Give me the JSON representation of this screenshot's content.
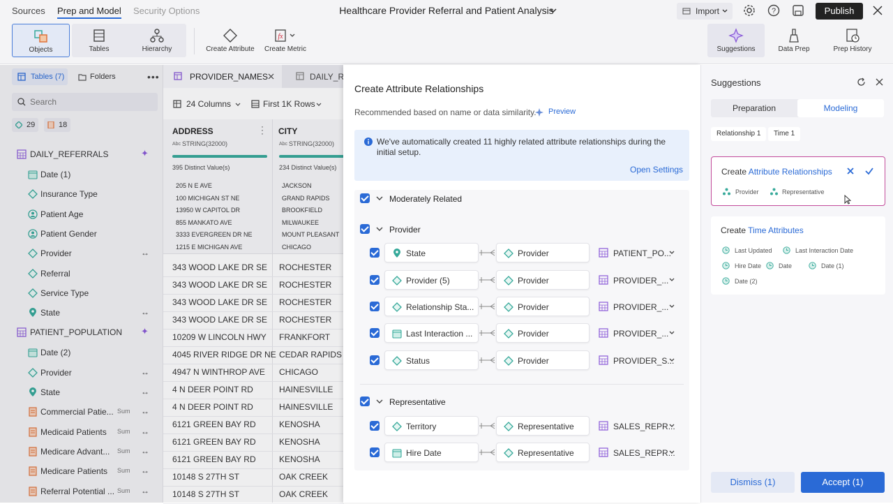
{
  "header": {
    "tabs": [
      "Sources",
      "Prep and Model",
      "Security Options"
    ],
    "title": "Healthcare Provider Referral and Patient Analysis",
    "import_label": "Import",
    "publish_label": "Publish"
  },
  "ribbon": {
    "left": [
      "Objects",
      "Tables",
      "Hierarchy",
      "Create Attribute",
      "Create Metric"
    ],
    "right": [
      "Suggestions",
      "Data Prep",
      "Prep History"
    ]
  },
  "left_panel": {
    "tables_tab": "Tables (7)",
    "folders_tab": "Folders",
    "search_placeholder": "Search",
    "attr_count": "29",
    "metric_count": "18",
    "groups": [
      {
        "name": "DAILY_REFERRALS",
        "items": [
          "Date (1)",
          "Insurance Type",
          "Patient Age",
          "Patient Gender",
          "Provider",
          "Referral",
          "Service Type",
          "State"
        ]
      },
      {
        "name": "PATIENT_POPULATION",
        "items": [
          "Date (2)",
          "Provider",
          "State",
          "Commercial Patie...",
          "Medicaid Patients",
          "Medicare Advant...",
          "Medicare Patients",
          "Referral Potential ..."
        ]
      }
    ],
    "sum_label": "Sum"
  },
  "grid": {
    "tab_active": "PROVIDER_NAMES",
    "tab_other": "DAILY_REF",
    "columns_label": "24 Columns",
    "rows_label": "First 1K Rows",
    "col1": {
      "name": "ADDRESS",
      "type": "STRING(32000)",
      "distinct": "395 Distinct Value(s)",
      "samples": [
        "205 N E AVE",
        "100 MICHIGAN ST NE",
        "13950 W CAPITOL DR",
        "855 MANKATO AVE",
        "3333 EVERGREEN DR NE",
        "1215 E MICHIGAN AVE"
      ],
      "rows": [
        "343 WOOD LAKE DR SE",
        "343 WOOD LAKE DR SE",
        "343 WOOD LAKE DR SE",
        "343 WOOD LAKE DR SE",
        "10209 W LINCOLN HWY",
        "4045 RIVER RIDGE DR NE",
        "4947 N WINTHROP AVE",
        "4 N DEER POINT RD",
        "4 N DEER POINT RD",
        "6121 GREEN BAY RD",
        "6121 GREEN BAY RD",
        "6121 GREEN BAY RD",
        "10148 S 27TH ST",
        "10148 S 27TH ST"
      ]
    },
    "col2": {
      "name": "CITY",
      "type": "STRING(32000)",
      "distinct": "234 Distinct Value(s)",
      "samples": [
        "JACKSON",
        "GRAND RAPIDS",
        "BROOKFIELD",
        "MILWAUKEE",
        "MOUNT PLEASANT",
        "CHICAGO"
      ],
      "rows": [
        "ROCHESTER",
        "ROCHESTER",
        "ROCHESTER",
        "ROCHESTER",
        "FRANKFORT",
        "CEDAR RAPIDS",
        "CHICAGO",
        "HAINESVILLE",
        "HAINESVILLE",
        "KENOSHA",
        "KENOSHA",
        "KENOSHA",
        "OAK CREEK",
        "OAK CREEK"
      ]
    },
    "type_badge": "Abc"
  },
  "dialog": {
    "title": "Create Attribute Relationships",
    "subtitle": "Recommended based on name or data similarity.",
    "preview": "Preview",
    "info": "We've automatically created 11 highly related attribute relationships during the initial setup.",
    "open_settings": "Open Settings",
    "sections": [
      {
        "name": "Moderately Related",
        "rows": []
      },
      {
        "name": "Provider",
        "rows": [
          {
            "left": "State",
            "right": "Provider",
            "table": "PATIENT_PO..."
          },
          {
            "left": "Provider (5)",
            "right": "Provider",
            "table": "PROVIDER_..."
          },
          {
            "left": "Relationship Sta...",
            "right": "Provider",
            "table": "PROVIDER_..."
          },
          {
            "left": "Last Interaction ...",
            "right": "Provider",
            "table": "PROVIDER_..."
          },
          {
            "left": "Status",
            "right": "Provider",
            "table": "PROVIDER_S..."
          }
        ]
      },
      {
        "name": "Representative",
        "rows": [
          {
            "left": "Territory",
            "right": "Representative",
            "table": "SALES_REPR..."
          },
          {
            "left": "Hire Date",
            "right": "Representative",
            "table": "SALES_REPR..."
          }
        ]
      }
    ]
  },
  "suggestions": {
    "title": "Suggestions",
    "tabs": [
      "Preparation",
      "Modeling"
    ],
    "filters": [
      "Relationship 1",
      "Time 1"
    ],
    "card1": {
      "prefix": "Create ",
      "link": "Attribute Relationships",
      "tags": [
        "Provider",
        "Representative"
      ]
    },
    "card2": {
      "prefix": "Create ",
      "link": "Time Attributes",
      "tags": [
        "Last Updated",
        "Last Interaction Date",
        "Hire Date",
        "Date",
        "Date (1)",
        "Date (2)"
      ]
    },
    "dismiss": "Dismiss (1)",
    "accept": "Accept (1)"
  },
  "colors": {
    "accent": "#2a6ad6",
    "teal": "#36a99a",
    "orange": "#e0733a",
    "purple": "#8a5ad8",
    "card_border": "#c24a9a"
  }
}
